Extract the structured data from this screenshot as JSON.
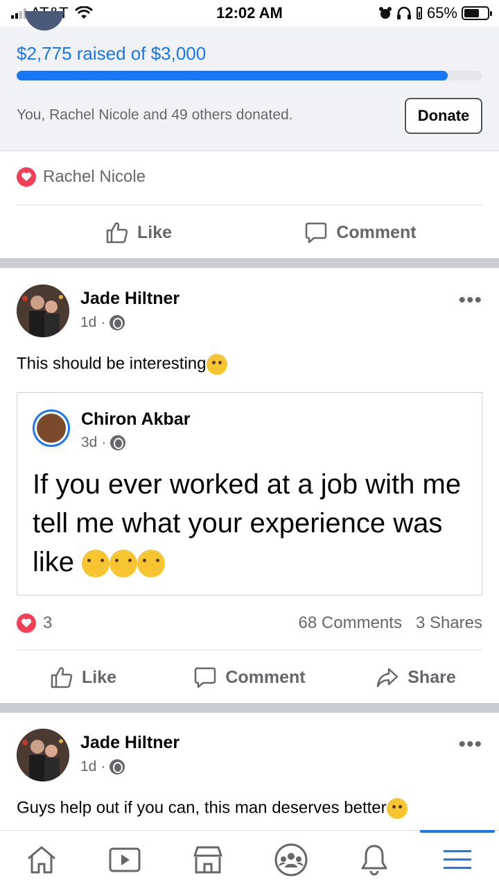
{
  "status_bar": {
    "carrier": "AT&T",
    "time": "12:02 AM",
    "battery": "65%",
    "battery_level": 0.65
  },
  "fundraiser": {
    "raised_text": "$2,775 raised of $3,000",
    "progress": 0.925,
    "donors_text": "You, Rachel Nicole and 49 others donated.",
    "donate_label": "Donate"
  },
  "post1": {
    "reaction_name": "Rachel Nicole",
    "like_label": "Like",
    "comment_label": "Comment"
  },
  "post2": {
    "author": "Jade Hiltner",
    "time": "1d",
    "text": "This should be interesting",
    "shared": {
      "author": "Chiron Akbar",
      "time": "3d",
      "text": "If you ever worked at a job with me tell me what your experience was like"
    },
    "reaction_count": "3",
    "comments": "68 Comments",
    "shares": "3 Shares",
    "like_label": "Like",
    "comment_label": "Comment",
    "share_label": "Share"
  },
  "post3": {
    "author": "Jade Hiltner",
    "time": "1d",
    "text": "Guys help out if you can, this man deserves better"
  },
  "colors": {
    "accent": "#1877f2",
    "heart": "#f33e58",
    "secondary_text": "#65676b",
    "section_bg": "#f0f2f5"
  },
  "bottom_nav": [
    "home-icon",
    "watch-icon",
    "marketplace-icon",
    "groups-icon",
    "notifications-icon",
    "menu-icon"
  ]
}
